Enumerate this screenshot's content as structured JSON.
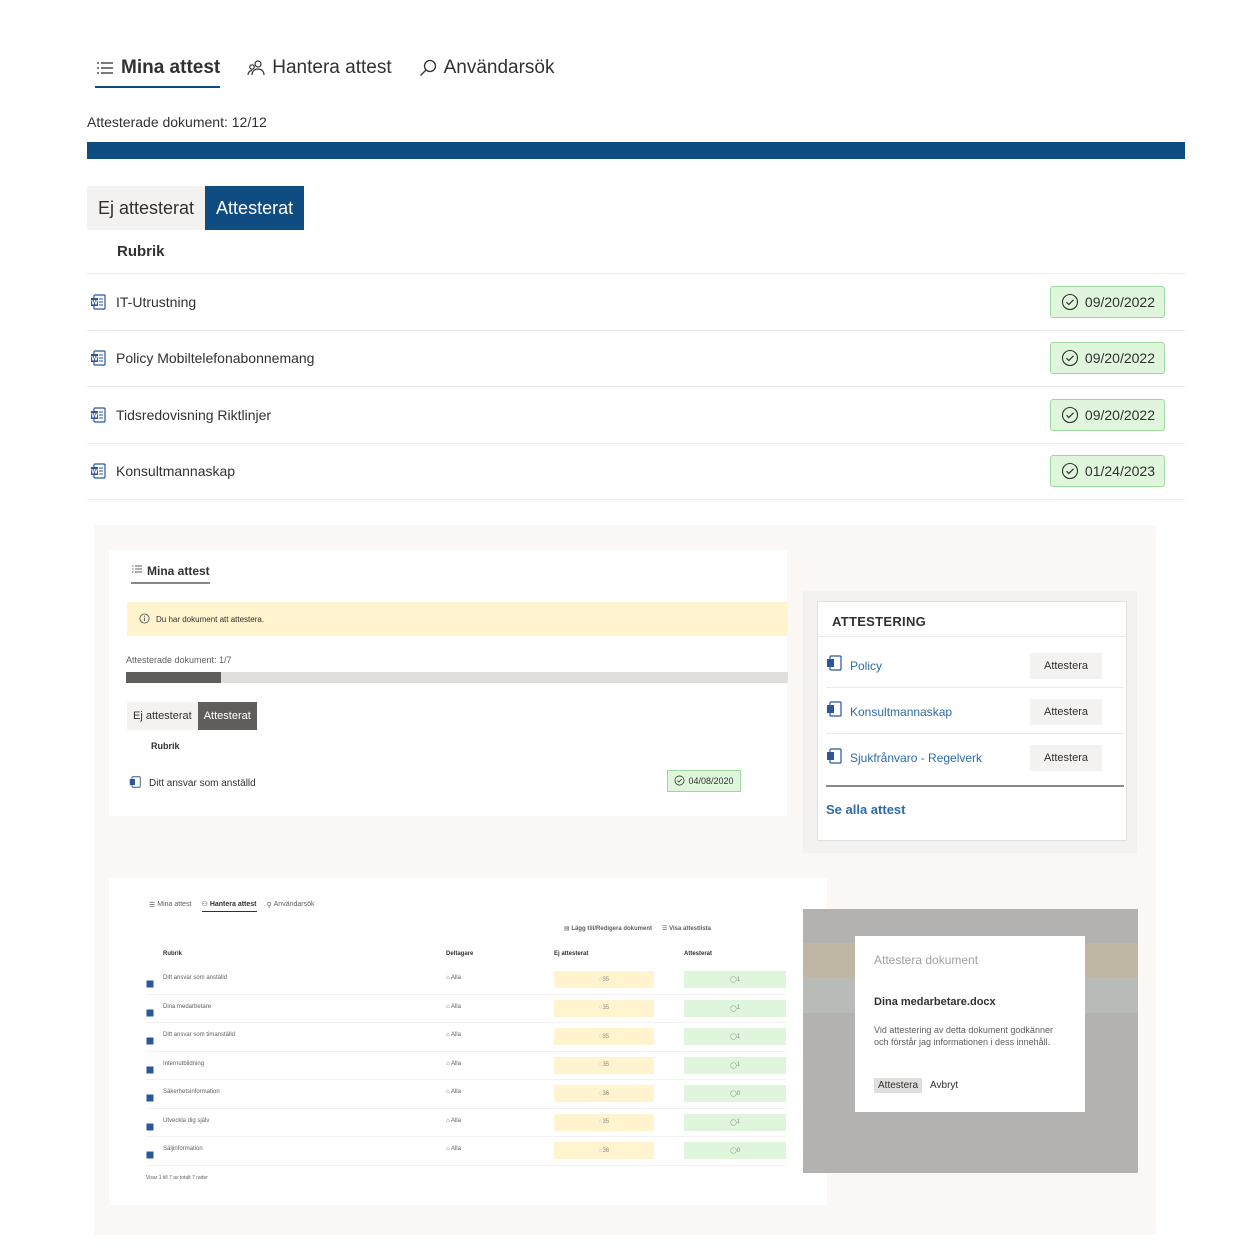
{
  "tabs": [
    {
      "label": "Mina attest",
      "icon": "list-icon",
      "active": true
    },
    {
      "label": "Hantera attest",
      "icon": "people-icon",
      "active": false
    },
    {
      "label": "Användarsök",
      "icon": "search-icon",
      "active": false
    }
  ],
  "progress": {
    "label": "Attesterade dokument: 12/12",
    "done": 12,
    "total": 12
  },
  "filter": {
    "not_attested": "Ej attesterat",
    "attested": "Attesterat",
    "selected": "Attesterat"
  },
  "table": {
    "column_header": "Rubrik",
    "rows": [
      {
        "title": "IT-Utrustning",
        "date": "09/20/2022"
      },
      {
        "title": "Policy Mobiltelefonabonnemang",
        "date": "09/20/2022"
      },
      {
        "title": "Tidsredovisning Riktlinjer",
        "date": "09/20/2022"
      },
      {
        "title": "Konsultmannaskap",
        "date": "01/24/2023"
      }
    ]
  },
  "colors": {
    "accent": "#0f4c81",
    "success_bg": "#dff6dd",
    "success_border": "#9fd89f",
    "warning_bg": "#fff4ce"
  },
  "preview": {
    "mina": {
      "tab": "Mina attest",
      "warning": "Du har dokument att attestera.",
      "progress_label": "Attesterade dokument: 1/7",
      "progress_done": 1,
      "progress_total": 7,
      "seg_not": "Ej attesterat",
      "seg_yes": "Attesterat",
      "header": "Rubrik",
      "row_title": "Ditt ansvar som anställd",
      "row_date": "04/08/2020"
    },
    "attestering": {
      "title": "ATTESTERING",
      "items": [
        {
          "name": "Policy",
          "button": "Attestera"
        },
        {
          "name": "Konsultmannaskap",
          "button": "Attestera"
        },
        {
          "name": "Sjukfrånvaro - Regelverk",
          "button": "Attestera"
        }
      ],
      "link": "Se alla attest"
    },
    "hantera": {
      "tabs": [
        "Mina attest",
        "Hantera attest",
        "Användarsök"
      ],
      "actions": [
        "Lägg till/Redigera dokument",
        "Visa attestlista"
      ],
      "headers": {
        "title": "Rubrik",
        "participants": "Deltagare",
        "not_attested": "Ej attesterat",
        "attested": "Attesterat"
      },
      "rows": [
        {
          "title": "Ditt ansvar som anställd",
          "participants": "Alla",
          "not_attested": "35",
          "attested": "1"
        },
        {
          "title": "Dina medarbetare",
          "participants": "Alla",
          "not_attested": "35",
          "attested": "1"
        },
        {
          "title": "Ditt ansvar som timanställd",
          "participants": "Alla",
          "not_attested": "35",
          "attested": "1"
        },
        {
          "title": "Internutbildning",
          "participants": "Alla",
          "not_attested": "35",
          "attested": "1"
        },
        {
          "title": "Säkerhetsinformation",
          "participants": "Alla",
          "not_attested": "36",
          "attested": "0"
        },
        {
          "title": "Utveckla dig själv",
          "participants": "Alla",
          "not_attested": "35",
          "attested": "1"
        },
        {
          "title": "Säljinformation",
          "participants": "Alla",
          "not_attested": "36",
          "attested": "0"
        }
      ],
      "footer": "Visar 1 till 7 av totalt 7 rader"
    },
    "dialog": {
      "title": "Attestera dokument",
      "document": "Dina medarbetare.docx",
      "text": "Vid attestering av detta dokument godkänner och förstår jag informationen i dess innehåll.",
      "confirm": "Attestera",
      "cancel": "Avbryt"
    }
  }
}
